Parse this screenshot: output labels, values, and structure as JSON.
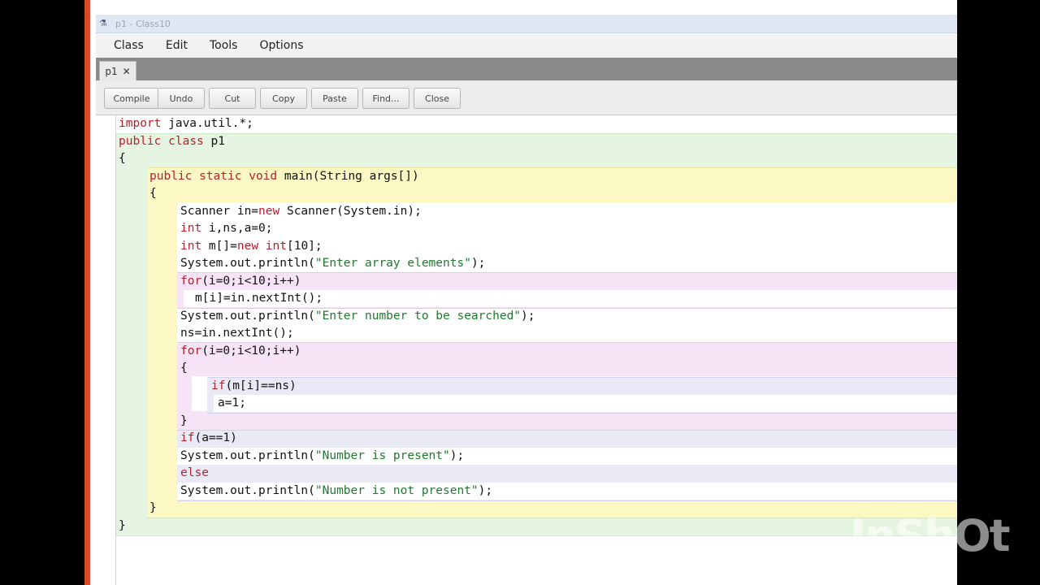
{
  "window": {
    "title": "p1 - Class10"
  },
  "menu": [
    "Class",
    "Edit",
    "Tools",
    "Options"
  ],
  "tab": {
    "label": "p1",
    "close": "✕"
  },
  "toolbar": [
    "Compile",
    "Undo",
    "Cut",
    "Copy",
    "Paste",
    "Find...",
    "Close"
  ],
  "code": [
    [
      "import",
      " java.util.*;"
    ],
    [
      "public",
      " ",
      "class",
      " p1"
    ],
    [
      "{"
    ],
    [
      "public static void",
      " main(String args[])"
    ],
    [
      "{"
    ],
    [
      "Scanner in=",
      "new",
      " Scanner(System.in);"
    ],
    [
      "int",
      " i,ns,a=0;"
    ],
    [
      "int",
      " m[]=",
      "new",
      " ",
      "int",
      "[10];"
    ],
    [
      "System.out.println(",
      "\"Enter array elements\"",
      ");"
    ],
    [
      "for",
      "(i=0;i<10;i++)"
    ],
    [
      "m[i]=in.nextInt();"
    ],
    [
      "System.out.println(",
      "\"Enter number to be searched\"",
      ");"
    ],
    [
      "ns=in.nextInt();"
    ],
    [
      "for",
      "(i=0;i<10;i++)"
    ],
    [
      "{"
    ],
    [
      "if",
      "(m[i]==ns)"
    ],
    [
      "a=1;"
    ],
    [
      "}"
    ],
    [
      "if",
      "(a==1)"
    ],
    [
      "System.out.println(",
      "\"Number is present\"",
      ");"
    ],
    [
      "else"
    ],
    [
      "System.out.println(",
      "\"Number is not present\"",
      ");"
    ],
    [
      "}"
    ],
    [
      "}"
    ]
  ],
  "watermark": "InShOt",
  "colors": {
    "class_scope": "#e6f5e1",
    "method_scope": "#fbf8c4",
    "loop_scope": "#f6e3f6",
    "if_scope": "#eaeaf7",
    "keyword": "#b8202e",
    "string": "#1f7a2e"
  }
}
